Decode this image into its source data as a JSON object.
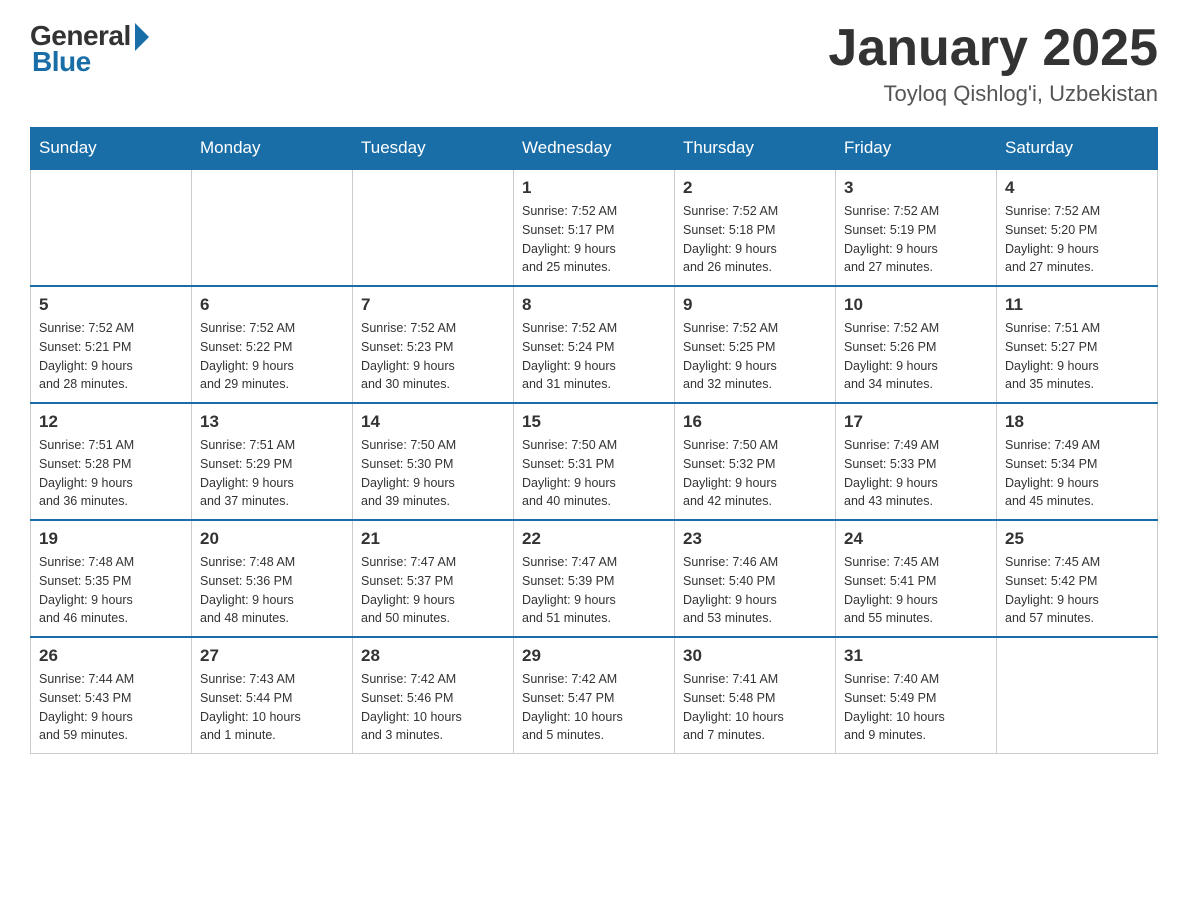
{
  "header": {
    "logo": {
      "general": "General",
      "blue": "Blue",
      "tagline": "Blue"
    },
    "title": "January 2025",
    "location": "Toyloq Qishlog'i, Uzbekistan"
  },
  "days_of_week": [
    "Sunday",
    "Monday",
    "Tuesday",
    "Wednesday",
    "Thursday",
    "Friday",
    "Saturday"
  ],
  "weeks": [
    [
      {
        "day": "",
        "info": ""
      },
      {
        "day": "",
        "info": ""
      },
      {
        "day": "",
        "info": ""
      },
      {
        "day": "1",
        "info": "Sunrise: 7:52 AM\nSunset: 5:17 PM\nDaylight: 9 hours\nand 25 minutes."
      },
      {
        "day": "2",
        "info": "Sunrise: 7:52 AM\nSunset: 5:18 PM\nDaylight: 9 hours\nand 26 minutes."
      },
      {
        "day": "3",
        "info": "Sunrise: 7:52 AM\nSunset: 5:19 PM\nDaylight: 9 hours\nand 27 minutes."
      },
      {
        "day": "4",
        "info": "Sunrise: 7:52 AM\nSunset: 5:20 PM\nDaylight: 9 hours\nand 27 minutes."
      }
    ],
    [
      {
        "day": "5",
        "info": "Sunrise: 7:52 AM\nSunset: 5:21 PM\nDaylight: 9 hours\nand 28 minutes."
      },
      {
        "day": "6",
        "info": "Sunrise: 7:52 AM\nSunset: 5:22 PM\nDaylight: 9 hours\nand 29 minutes."
      },
      {
        "day": "7",
        "info": "Sunrise: 7:52 AM\nSunset: 5:23 PM\nDaylight: 9 hours\nand 30 minutes."
      },
      {
        "day": "8",
        "info": "Sunrise: 7:52 AM\nSunset: 5:24 PM\nDaylight: 9 hours\nand 31 minutes."
      },
      {
        "day": "9",
        "info": "Sunrise: 7:52 AM\nSunset: 5:25 PM\nDaylight: 9 hours\nand 32 minutes."
      },
      {
        "day": "10",
        "info": "Sunrise: 7:52 AM\nSunset: 5:26 PM\nDaylight: 9 hours\nand 34 minutes."
      },
      {
        "day": "11",
        "info": "Sunrise: 7:51 AM\nSunset: 5:27 PM\nDaylight: 9 hours\nand 35 minutes."
      }
    ],
    [
      {
        "day": "12",
        "info": "Sunrise: 7:51 AM\nSunset: 5:28 PM\nDaylight: 9 hours\nand 36 minutes."
      },
      {
        "day": "13",
        "info": "Sunrise: 7:51 AM\nSunset: 5:29 PM\nDaylight: 9 hours\nand 37 minutes."
      },
      {
        "day": "14",
        "info": "Sunrise: 7:50 AM\nSunset: 5:30 PM\nDaylight: 9 hours\nand 39 minutes."
      },
      {
        "day": "15",
        "info": "Sunrise: 7:50 AM\nSunset: 5:31 PM\nDaylight: 9 hours\nand 40 minutes."
      },
      {
        "day": "16",
        "info": "Sunrise: 7:50 AM\nSunset: 5:32 PM\nDaylight: 9 hours\nand 42 minutes."
      },
      {
        "day": "17",
        "info": "Sunrise: 7:49 AM\nSunset: 5:33 PM\nDaylight: 9 hours\nand 43 minutes."
      },
      {
        "day": "18",
        "info": "Sunrise: 7:49 AM\nSunset: 5:34 PM\nDaylight: 9 hours\nand 45 minutes."
      }
    ],
    [
      {
        "day": "19",
        "info": "Sunrise: 7:48 AM\nSunset: 5:35 PM\nDaylight: 9 hours\nand 46 minutes."
      },
      {
        "day": "20",
        "info": "Sunrise: 7:48 AM\nSunset: 5:36 PM\nDaylight: 9 hours\nand 48 minutes."
      },
      {
        "day": "21",
        "info": "Sunrise: 7:47 AM\nSunset: 5:37 PM\nDaylight: 9 hours\nand 50 minutes."
      },
      {
        "day": "22",
        "info": "Sunrise: 7:47 AM\nSunset: 5:39 PM\nDaylight: 9 hours\nand 51 minutes."
      },
      {
        "day": "23",
        "info": "Sunrise: 7:46 AM\nSunset: 5:40 PM\nDaylight: 9 hours\nand 53 minutes."
      },
      {
        "day": "24",
        "info": "Sunrise: 7:45 AM\nSunset: 5:41 PM\nDaylight: 9 hours\nand 55 minutes."
      },
      {
        "day": "25",
        "info": "Sunrise: 7:45 AM\nSunset: 5:42 PM\nDaylight: 9 hours\nand 57 minutes."
      }
    ],
    [
      {
        "day": "26",
        "info": "Sunrise: 7:44 AM\nSunset: 5:43 PM\nDaylight: 9 hours\nand 59 minutes."
      },
      {
        "day": "27",
        "info": "Sunrise: 7:43 AM\nSunset: 5:44 PM\nDaylight: 10 hours\nand 1 minute."
      },
      {
        "day": "28",
        "info": "Sunrise: 7:42 AM\nSunset: 5:46 PM\nDaylight: 10 hours\nand 3 minutes."
      },
      {
        "day": "29",
        "info": "Sunrise: 7:42 AM\nSunset: 5:47 PM\nDaylight: 10 hours\nand 5 minutes."
      },
      {
        "day": "30",
        "info": "Sunrise: 7:41 AM\nSunset: 5:48 PM\nDaylight: 10 hours\nand 7 minutes."
      },
      {
        "day": "31",
        "info": "Sunrise: 7:40 AM\nSunset: 5:49 PM\nDaylight: 10 hours\nand 9 minutes."
      },
      {
        "day": "",
        "info": ""
      }
    ]
  ]
}
